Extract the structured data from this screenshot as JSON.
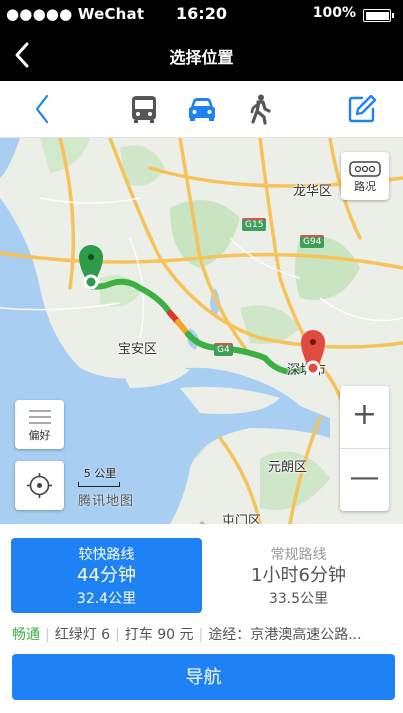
{
  "status_bar": {
    "carrier": "●●●●● WeChat",
    "time": "16:20",
    "battery": "100%"
  },
  "nav": {
    "title": "选择位置",
    "back_icon": "chevron-left-icon"
  },
  "mode_bar": {
    "back_icon": "chevron-left-icon",
    "modes": [
      "bus-icon",
      "car-icon",
      "walk-icon"
    ],
    "selected_mode": "car-icon",
    "edit_icon": "edit-icon",
    "accent": "#1e82f5"
  },
  "map": {
    "labels": {
      "longhua": "龙华区",
      "baoan": "宝安区",
      "shenzhen": "深圳市",
      "yuenlong": "元朗区",
      "tuenmun": "屯门区"
    },
    "shields": {
      "g15": "G15",
      "g94": "G94",
      "g4": "G4"
    },
    "traffic_label": "路况",
    "preference_label": "偏好",
    "zoom_in": "+",
    "zoom_out": "—",
    "scale": "5 公里",
    "logo": "腾讯地图",
    "route_colors": {
      "smooth": "#3cb043",
      "slow": "#f5a623",
      "jam": "#e0362c"
    }
  },
  "routes": [
    {
      "name": "较快路线",
      "duration": "44分钟",
      "distance": "32.4公里",
      "active": true
    },
    {
      "name": "常规路线",
      "duration": "1小时6分钟",
      "distance": "33.5公里",
      "active": false
    }
  ],
  "info": {
    "status": "畅通",
    "lights": "红绿灯 6",
    "taxi": "打车 90 元",
    "via": "途经：京港澳高速公路..."
  },
  "navigate_label": "导航"
}
